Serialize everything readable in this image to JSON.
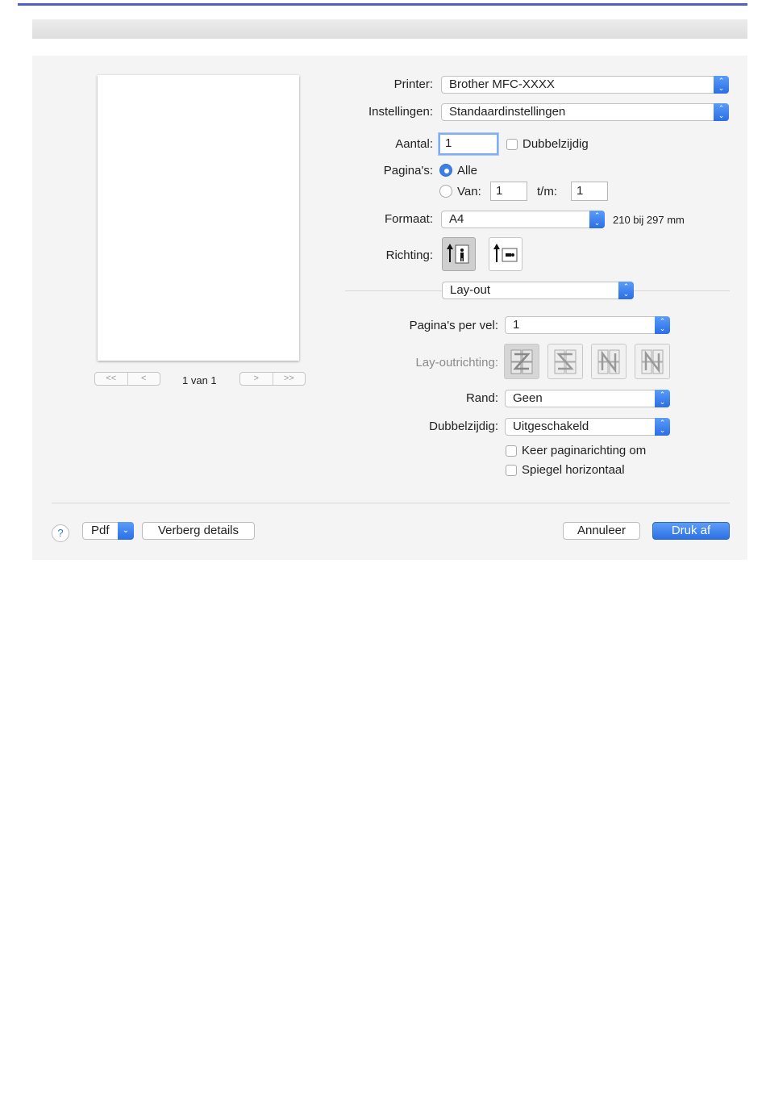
{
  "preview": {
    "page_indicator": "1 van 1",
    "nav_first": "<<",
    "nav_prev": "<",
    "nav_next": ">",
    "nav_last": ">>"
  },
  "printer": {
    "label": "Printer:",
    "value": "Brother MFC-XXXX"
  },
  "presets": {
    "label": "Instellingen:",
    "value": "Standaardinstellingen"
  },
  "copies": {
    "label": "Aantal:",
    "value": "1",
    "duplex_label": "Dubbelzijdig",
    "duplex_checked": false
  },
  "pages": {
    "label": "Pagina's:",
    "all_label": "Alle",
    "range_label": "Van:",
    "from": "1",
    "to_label": "t/m:",
    "to": "1",
    "selected": "all"
  },
  "paper_size": {
    "label": "Formaat:",
    "value": "A4",
    "dimensions": "210 bij 297 mm"
  },
  "orientation": {
    "label": "Richting:",
    "selected": "portrait"
  },
  "section": {
    "value": "Lay-out"
  },
  "layout": {
    "pages_per_sheet": {
      "label": "Pagina's per vel:",
      "value": "1"
    },
    "direction": {
      "label": "Lay-outrichting:",
      "enabled": false,
      "options": [
        "Z",
        "S",
        "N-reversed",
        "N"
      ]
    },
    "border": {
      "label": "Rand:",
      "value": "Geen"
    },
    "two_sided": {
      "label": "Dubbelzijdig:",
      "value": "Uitgeschakeld"
    },
    "reverse_orientation": {
      "label": "Keer paginarichting om",
      "checked": false
    },
    "flip_horizontal": {
      "label": "Spiegel horizontaal",
      "checked": false
    }
  },
  "footer": {
    "help": "?",
    "pdf": "Pdf",
    "hide_details": "Verberg details",
    "cancel": "Annuleer",
    "print": "Druk af"
  },
  "colors": {
    "accent": "#2c70e4",
    "top_rule": "#4b5fc4"
  }
}
